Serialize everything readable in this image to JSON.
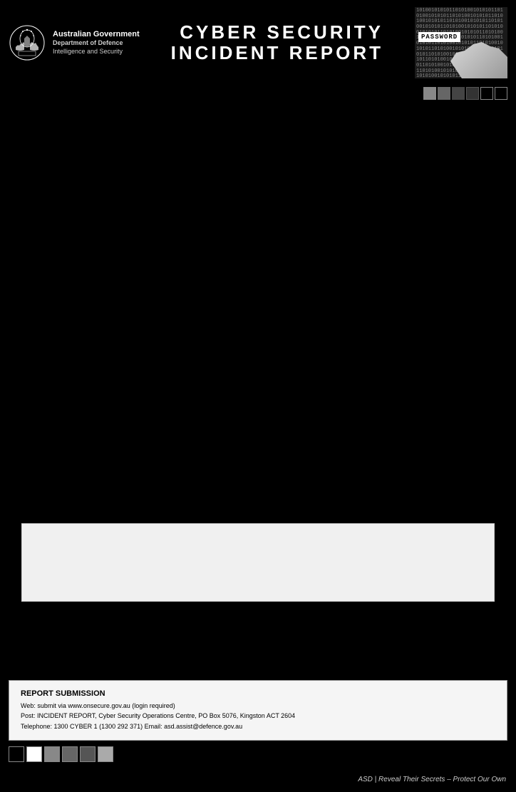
{
  "header": {
    "gov_name": "Australian Government",
    "dept_name": "Department of Defence",
    "dept_sub": "Intelligence and Security",
    "title_line1": "CYBER SECURITY",
    "title_line2": "INCIDENT REPORT",
    "image_alt": "Password cyber security image"
  },
  "color_squares_header": [
    "#888",
    "#666",
    "#444",
    "#333",
    "#fff",
    "#fff"
  ],
  "color_squares_footer": [
    "#fff",
    "#fff",
    "#888",
    "#666",
    "#555",
    "#aaa"
  ],
  "grey_box": {
    "content": ""
  },
  "submission": {
    "title": "REPORT SUBMISSION",
    "line1": "Web: submit via www.onsecure.gov.au (login required)",
    "line2": "Post: INCIDENT REPORT, Cyber Security Operations Centre, PO Box 5076, Kingston ACT 2604",
    "line3": "Telephone: 1300 CYBER 1 (1300 292 371)  Email: asd.assist@defence.gov.au"
  },
  "footer": {
    "tagline": "ASD | Reveal Their Secrets – Protect Our Own"
  }
}
